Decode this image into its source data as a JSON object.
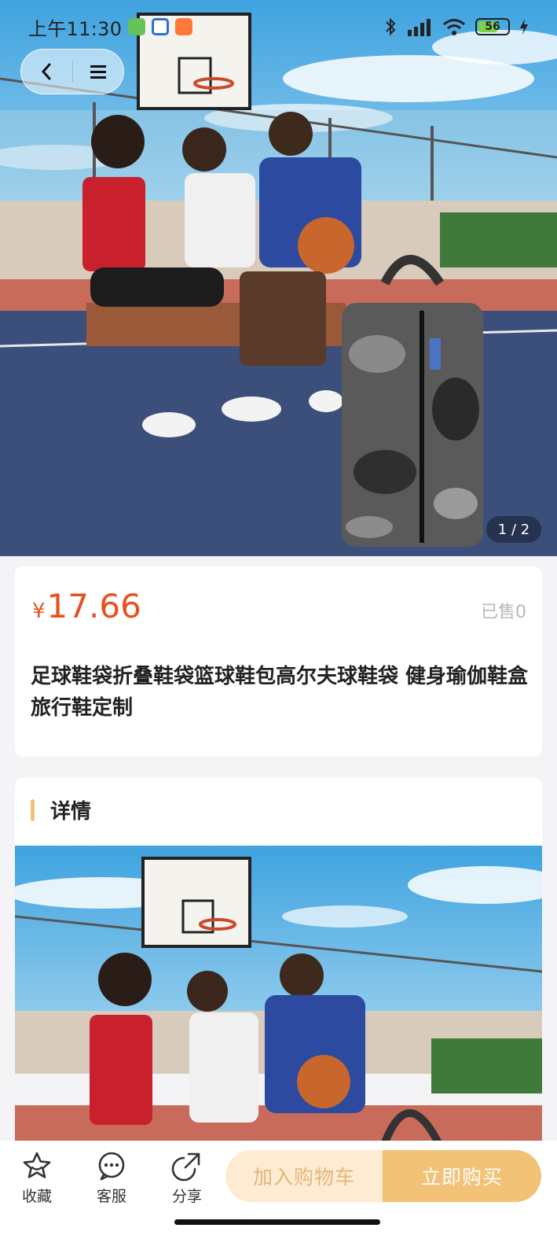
{
  "status_bar": {
    "time": "上午11:30",
    "battery": "56"
  },
  "hero": {
    "counter": "1 / 2"
  },
  "product": {
    "currency": "¥",
    "price": "17.66",
    "sold": "已售0",
    "title": "足球鞋袋折叠鞋袋篮球鞋包高尔夫球鞋袋 健身瑜伽鞋盒旅行鞋定制"
  },
  "details": {
    "label": "详情"
  },
  "bottom_bar": {
    "favorite": "收藏",
    "service": "客服",
    "share": "分享",
    "add_to_cart": "加入购物车",
    "buy_now": "立即购买"
  },
  "colors": {
    "price": "#e8501e",
    "accent": "#f2c276",
    "accent_light": "#fdecd2"
  },
  "icons": [
    "back-icon",
    "menu-icon",
    "bluetooth-icon",
    "signal-icon",
    "wifi-icon",
    "battery-icon",
    "star-icon",
    "chat-icon",
    "share-icon"
  ]
}
